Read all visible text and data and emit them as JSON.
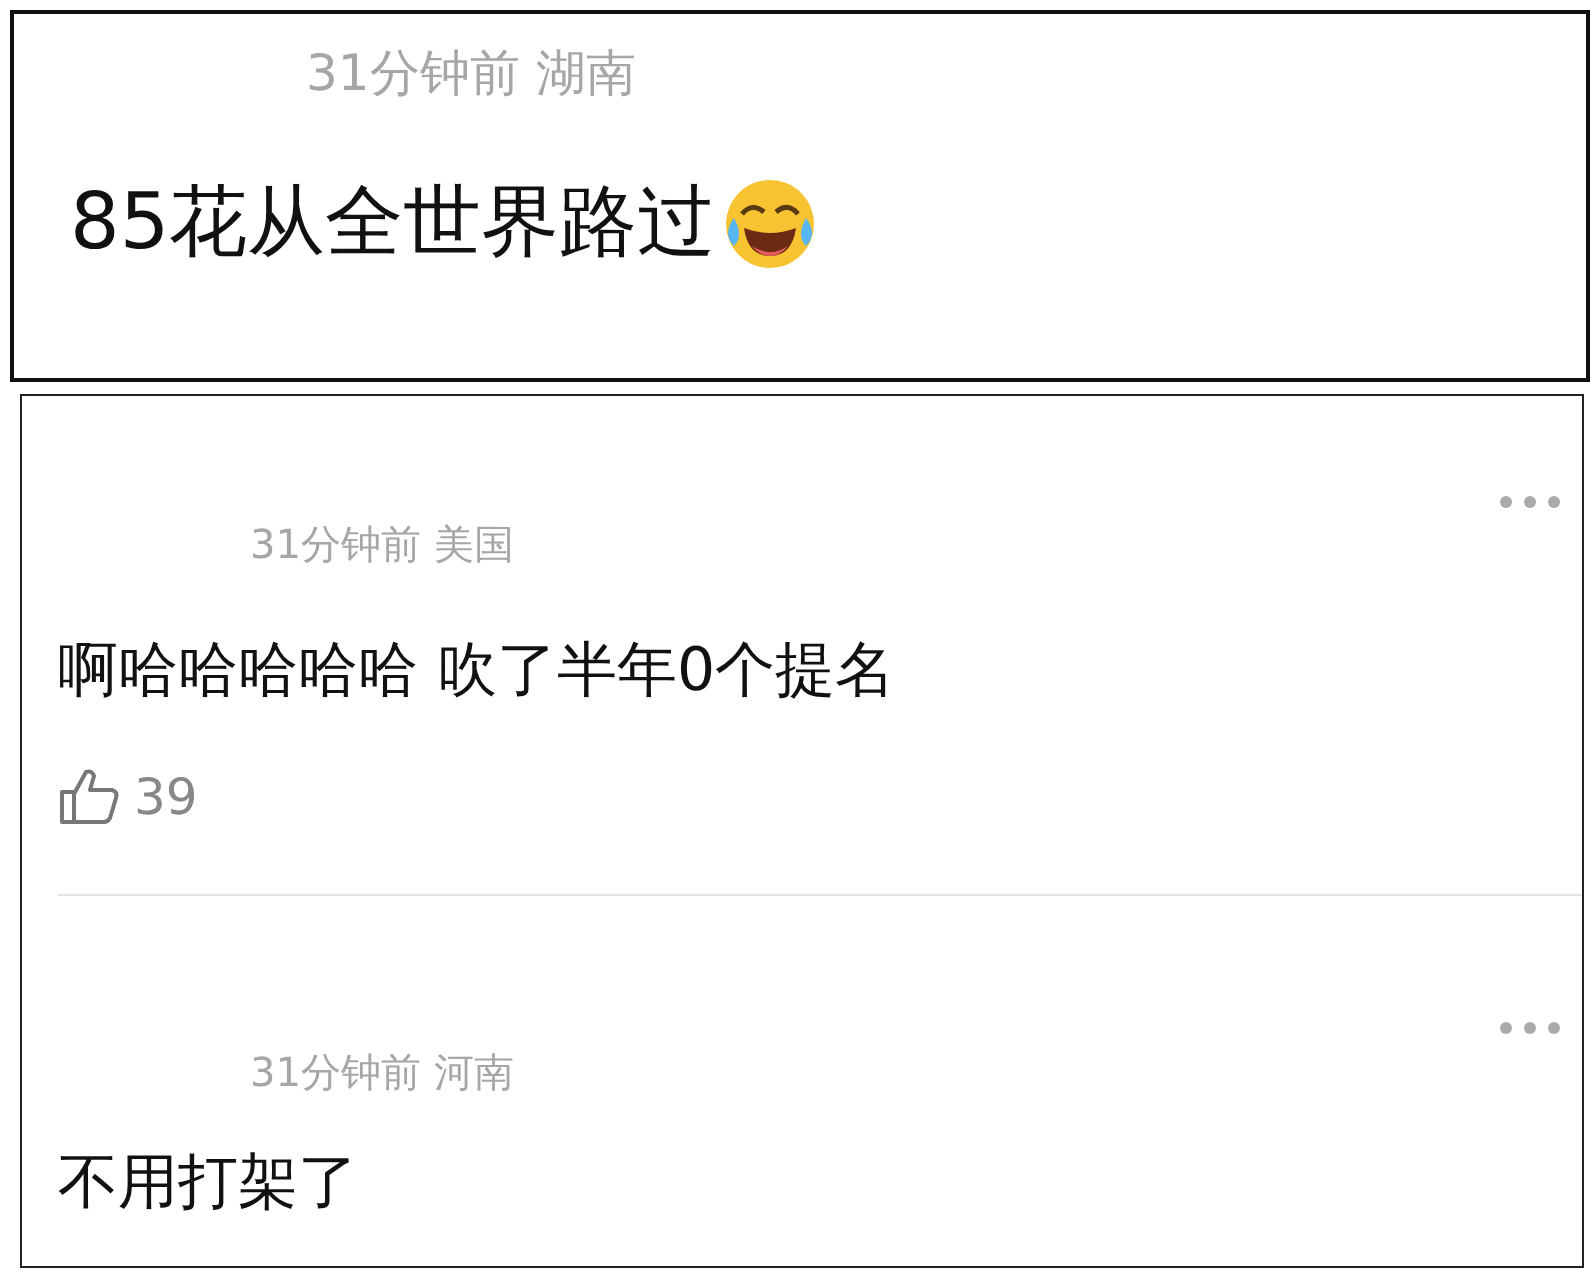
{
  "top_comment": {
    "meta": "31分钟前 湖南",
    "text": "85花从全世界路过"
  },
  "comments": [
    {
      "meta": "31分钟前 美国",
      "text": "啊哈哈哈哈哈 吹了半年0个提名",
      "likes": "39"
    },
    {
      "meta": "31分钟前 河南",
      "text": "不用打架了"
    }
  ]
}
